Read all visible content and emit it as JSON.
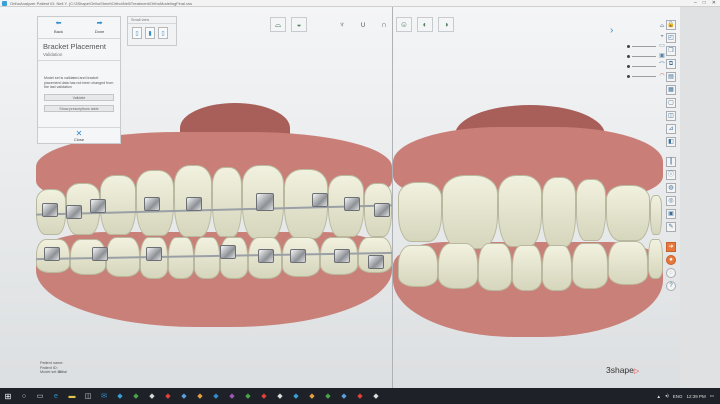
{
  "window": {
    "title": "OrthoAnalyzer Patient ID: Neil Y. (C:\\3Shape\\OrthoSheet\\Ortho\\Neil\\Treatment\\OrthoModelingFinal.vss"
  },
  "panel": {
    "back_label": "Back",
    "done_label": "Done",
    "heading": "Bracket Placement",
    "subheading": "Validation",
    "message": "Model set is validated and bracket placement data has not been changed from the last validation",
    "validate_label": "Validate",
    "show_table_label": "Show prescriptions table",
    "close_label": "Close"
  },
  "small_view": {
    "header": "Small view"
  },
  "toolbar_icons": [
    "upper-jaw-icon",
    "lower-jaw-icon",
    "tooth-icon",
    "arch-icon",
    "arch-lower-icon",
    "jaw-front-icon",
    "jaw-side-icon",
    "jaw-occlusal-icon"
  ],
  "patient": {
    "name_label": "Patient name:",
    "id_label": "Patient ID:",
    "model_set_label": "Model set ID:",
    "model_set_value": "Initial"
  },
  "logo": {
    "text": "3shape"
  },
  "taskbar": {
    "time": "12:39 PM",
    "language": "ENG"
  },
  "colors": {
    "accent": "#2e8fd0",
    "gum": "#c97f78",
    "tooth": "#e8e8d2",
    "brand_triangle": "#e5403a"
  }
}
